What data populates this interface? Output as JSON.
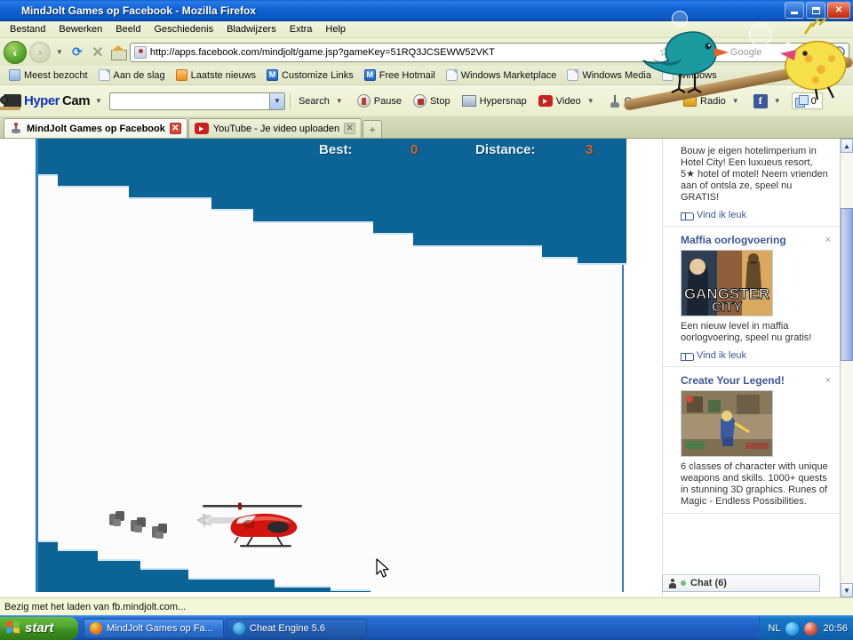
{
  "window": {
    "title": "MindJolt Games op Facebook - Mozilla Firefox",
    "minimize_label": "Minimaliseren",
    "maximize_label": "Maximaliseren",
    "close_label": "Sluiten"
  },
  "menu": {
    "items": [
      "Bestand",
      "Bewerken",
      "Beeld",
      "Geschiedenis",
      "Bladwijzers",
      "Extra",
      "Help"
    ]
  },
  "nav": {
    "back_label": "Vorige",
    "forward_label": "Volgende",
    "reload_label": "Herladen",
    "stop_label": "Stoppen",
    "home_label": "Startpagina",
    "url": "http://apps.facebook.com/mindjolt/game.jsp?gameKey=51RQ3JCSEWW52VKT",
    "bookmark_star": "☆",
    "search_placeholder": "Google"
  },
  "bookmarks": {
    "items": [
      {
        "label": "Meest bezocht",
        "icon": "star-folder-icon"
      },
      {
        "label": "Aan de slag",
        "icon": "document-icon"
      },
      {
        "label": "Laatste nieuws",
        "icon": "rss-icon"
      },
      {
        "label": "Customize Links",
        "icon": "m-icon"
      },
      {
        "label": "Free Hotmail",
        "icon": "m-icon"
      },
      {
        "label": "Windows Marketplace",
        "icon": "document-icon"
      },
      {
        "label": "Windows Media",
        "icon": "document-icon"
      },
      {
        "label": "Windows",
        "icon": "document-icon"
      }
    ]
  },
  "hypercam": {
    "brand_first": "Hyper",
    "brand_second": "Cam",
    "search_value": "",
    "items": [
      {
        "label": "Search",
        "icon": "search-icon",
        "has_arrow": true
      },
      {
        "label": "Pause",
        "icon": "pause-icon",
        "has_arrow": false
      },
      {
        "label": "Stop",
        "icon": "stop-icon",
        "has_arrow": false
      },
      {
        "label": "Hypersnap",
        "icon": "snapshot-icon",
        "has_arrow": false
      },
      {
        "label": "Video",
        "icon": "youtube-icon",
        "has_arrow": true
      },
      {
        "label": "Games",
        "icon": "joystick-icon",
        "has_arrow": true
      },
      {
        "label": "Radio",
        "icon": "radio-icon",
        "has_arrow": true
      }
    ],
    "facebook_label": "f",
    "notification_count": "0"
  },
  "tabs": [
    {
      "label": "MindJolt Games op Facebook",
      "active": true
    },
    {
      "label": "YouTube - Je video uploaden",
      "active": false
    }
  ],
  "tab_new_label": "+",
  "game": {
    "best_label": "Best:",
    "best_value": "0",
    "distance_label": "Distance:",
    "distance_value": "3",
    "banner_color": "#0b6396",
    "terrain_color": "#0b6396",
    "helicopter": "red-helicopter-sprite",
    "smoke": "smoke-puff"
  },
  "sidebar": {
    "ads": [
      {
        "title": "",
        "body": "Bouw je eigen hotelimperium in Hotel City! Een luxueus resort, 5★ hotel of motel! Neem vrienden aan of ontsla ze, speel nu GRATIS!",
        "like_label": "Vind ik leuk",
        "close_label": "×",
        "has_image": false
      },
      {
        "title": "Maffia oorlogvoering",
        "body": "Een nieuw level in maffia oorlogvoering, speel nu gratis!",
        "like_label": "Vind ik leuk",
        "close_label": "×",
        "has_image": true,
        "image_caption": "GANGSTER CITY"
      },
      {
        "title": "Create Your Legend!",
        "body": "6 classes of character with unique weapons and skills. 1000+ quests in stunning 3D graphics. Runes of Magic - Endless Possibilities.",
        "like_label": "",
        "close_label": "×",
        "has_image": true,
        "image_caption": ""
      }
    ],
    "chat_label": "Chat (6)"
  },
  "status": {
    "text": "Bezig met het laden van fb.mindjolt.com..."
  },
  "taskbar": {
    "start_label": "start",
    "items": [
      {
        "label": "MindJolt Games op Fa...",
        "icon": "firefox-icon",
        "selected": false
      },
      {
        "label": "Cheat Engine 5.6",
        "icon": "cheat-engine-icon",
        "selected": true
      }
    ],
    "tray": {
      "language": "NL",
      "clock": "20:56"
    }
  },
  "cursor": {
    "label": "mouse-pointer"
  }
}
